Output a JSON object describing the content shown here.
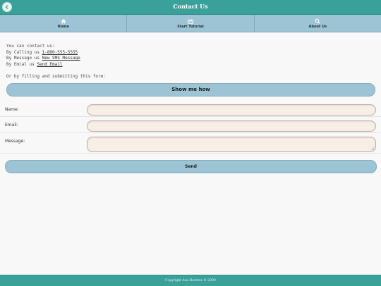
{
  "header": {
    "title": "Contact Us",
    "back_icon": "back-arrow-icon"
  },
  "nav": {
    "items": [
      {
        "label": "Home",
        "icon": "home-icon"
      },
      {
        "label": "Start Tutorial",
        "icon": "tutorial-icon"
      },
      {
        "label": "About Us",
        "icon": "search-icon"
      }
    ]
  },
  "contact": {
    "intro": "You can contact us:",
    "phone_prefix": "By Calling us",
    "phone": "1-800-555-5555",
    "sms_prefix": "By Message us",
    "sms_link": "New SMS Message",
    "email_prefix": "By Emial us",
    "email_link": "Send Email",
    "form_intro": "Or by filling and submitting this form:"
  },
  "show_button": "Show me how",
  "form": {
    "name_label": "Name:",
    "email_label": "Email:",
    "message_label": "Message:",
    "name_value": "",
    "email_value": "",
    "message_value": ""
  },
  "send_button": "Send",
  "footer": {
    "text": "Copyright Ana Herrera © 2000"
  },
  "colors": {
    "header_bg": "#3aa19a",
    "nav_bg": "#9cc4d4",
    "input_bg": "#f7efe6"
  }
}
